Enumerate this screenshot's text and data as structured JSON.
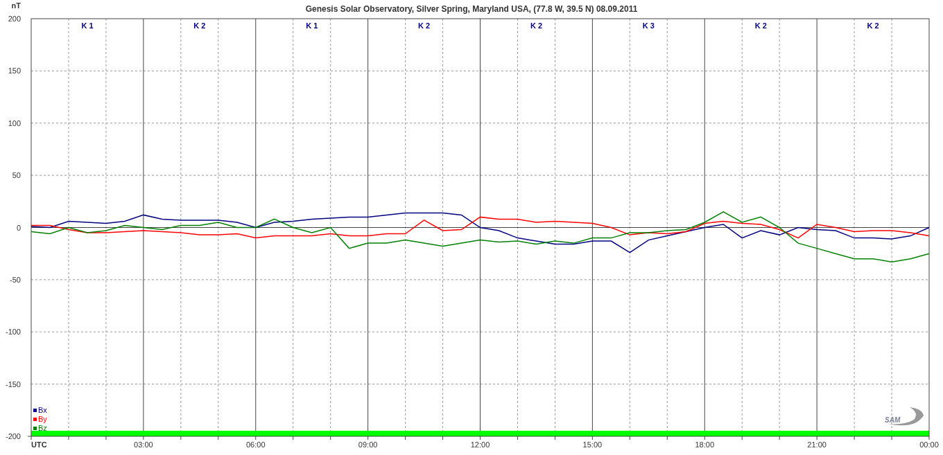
{
  "chart": {
    "chart_data": {
      "type": "line",
      "title": "Genesis Solar Observatory, Silver Spring, Maryland USA, (77.8 W, 39.5 N)  08.09.2011",
      "ylabel": "nT",
      "xlabel": "UTC",
      "x": [
        0,
        0.5,
        1,
        1.5,
        2,
        2.5,
        3,
        3.5,
        4,
        4.5,
        5,
        5.5,
        6,
        6.5,
        7,
        7.5,
        8,
        8.5,
        9,
        9.5,
        10,
        10.5,
        11,
        11.5,
        12,
        12.5,
        13,
        13.5,
        14,
        14.5,
        15,
        15.5,
        16,
        16.5,
        17,
        17.5,
        18,
        18.5,
        19,
        19.5,
        20,
        20.5,
        21,
        21.5,
        22,
        22.5,
        23,
        23.5,
        24
      ],
      "xlim": [
        0,
        24
      ],
      "ylim": [
        -200,
        200
      ],
      "xticks": [
        {
          "value": 3,
          "label": "03:00"
        },
        {
          "value": 6,
          "label": "06:00"
        },
        {
          "value": 9,
          "label": "09:00"
        },
        {
          "value": 12,
          "label": "12:00"
        },
        {
          "value": 15,
          "label": "15:00"
        },
        {
          "value": 18,
          "label": "18:00"
        },
        {
          "value": 21,
          "label": "21:00"
        },
        {
          "value": 24,
          "label": "00:00"
        }
      ],
      "yticks": [
        200,
        150,
        100,
        50,
        0,
        -50,
        -100,
        -150,
        -200
      ],
      "series": [
        {
          "name": "Bx",
          "color": "#000080",
          "values": [
            1,
            0,
            6,
            5,
            4,
            6,
            12,
            8,
            7,
            7,
            7,
            5,
            0,
            5,
            6,
            8,
            9,
            10,
            10,
            12,
            14,
            14,
            14,
            12,
            0,
            -3,
            -10,
            -13,
            -16,
            -16,
            -13,
            -13,
            -24,
            -12,
            -8,
            -4,
            0,
            3,
            -10,
            -3,
            -7,
            0,
            -2,
            -3,
            -10,
            -10,
            -11,
            -8,
            0
          ]
        },
        {
          "name": "By",
          "color": "#ff0000",
          "values": [
            2,
            2,
            -2,
            -5,
            -5,
            -4,
            -3,
            -4,
            -5,
            -7,
            -7,
            -6,
            -10,
            -8,
            -8,
            -8,
            -6,
            -8,
            -8,
            -6,
            -6,
            7,
            -3,
            -2,
            10,
            8,
            8,
            5,
            6,
            5,
            4,
            0,
            -7,
            -5,
            -6,
            -4,
            4,
            6,
            4,
            3,
            -2,
            -10,
            3,
            0,
            -4,
            -3,
            -3,
            -5,
            -8
          ]
        },
        {
          "name": "Bz",
          "color": "#008000",
          "values": [
            -4,
            -6,
            0,
            -5,
            -3,
            2,
            0,
            -2,
            2,
            2,
            5,
            0,
            0,
            8,
            0,
            -5,
            0,
            -20,
            -15,
            -15,
            -12,
            -15,
            -18,
            -15,
            -12,
            -14,
            -13,
            -16,
            -13,
            -15,
            -10,
            -10,
            -5,
            -5,
            -3,
            -2,
            5,
            15,
            5,
            10,
            0,
            -15,
            -20,
            -25,
            -30,
            -30,
            -33,
            -30,
            -25
          ]
        }
      ],
      "grid": true,
      "legend": "lower left"
    },
    "k_indices": [
      "K 1",
      "K 2",
      "K 1",
      "K 2",
      "K 2",
      "K 3",
      "K 2",
      "K 2"
    ]
  },
  "logo": "SAM"
}
